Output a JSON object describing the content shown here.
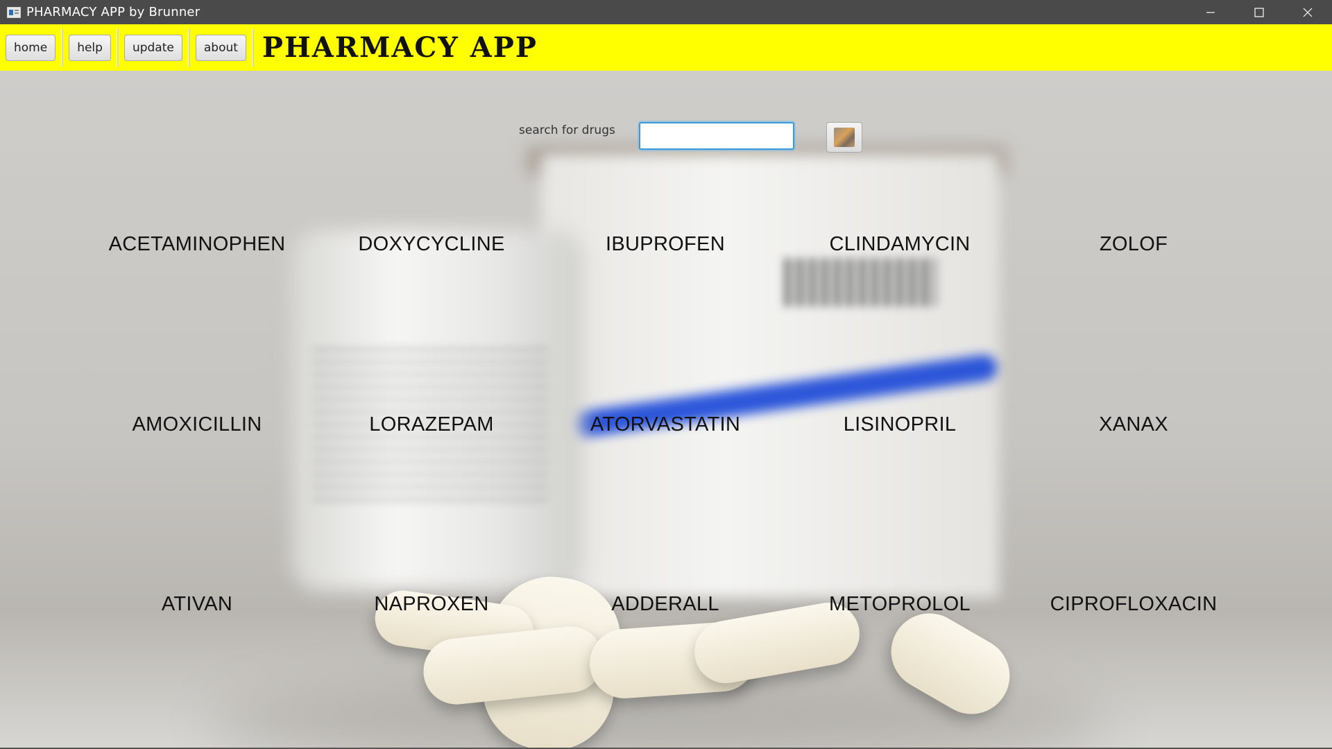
{
  "window": {
    "title": "PHARMACY APP by Brunner",
    "controls": [
      "minimize-icon",
      "maximize-icon",
      "close-icon"
    ]
  },
  "toolbar": {
    "background": "#ffff00",
    "buttons": [
      {
        "label": "home"
      },
      {
        "label": "help"
      },
      {
        "label": "update"
      },
      {
        "label": "about"
      }
    ],
    "app_title": "PHARMACY APP"
  },
  "search": {
    "label": "search for drugs",
    "value": "",
    "placeholder": ""
  },
  "drugs": {
    "rows": [
      [
        "ACETAMINOPHEN",
        "DOXYCYCLINE",
        "IBUPROFEN",
        "CLINDAMYCIN",
        "ZOLOF"
      ],
      [
        "AMOXICILLIN",
        "LORAZEPAM",
        "ATORVASTATIN",
        "LISINOPRIL",
        "XANAX"
      ],
      [
        "ATIVAN",
        "NAPROXEN",
        "ADDERALL",
        "METOPROLOL",
        "CIPROFLOXACIN"
      ]
    ]
  }
}
